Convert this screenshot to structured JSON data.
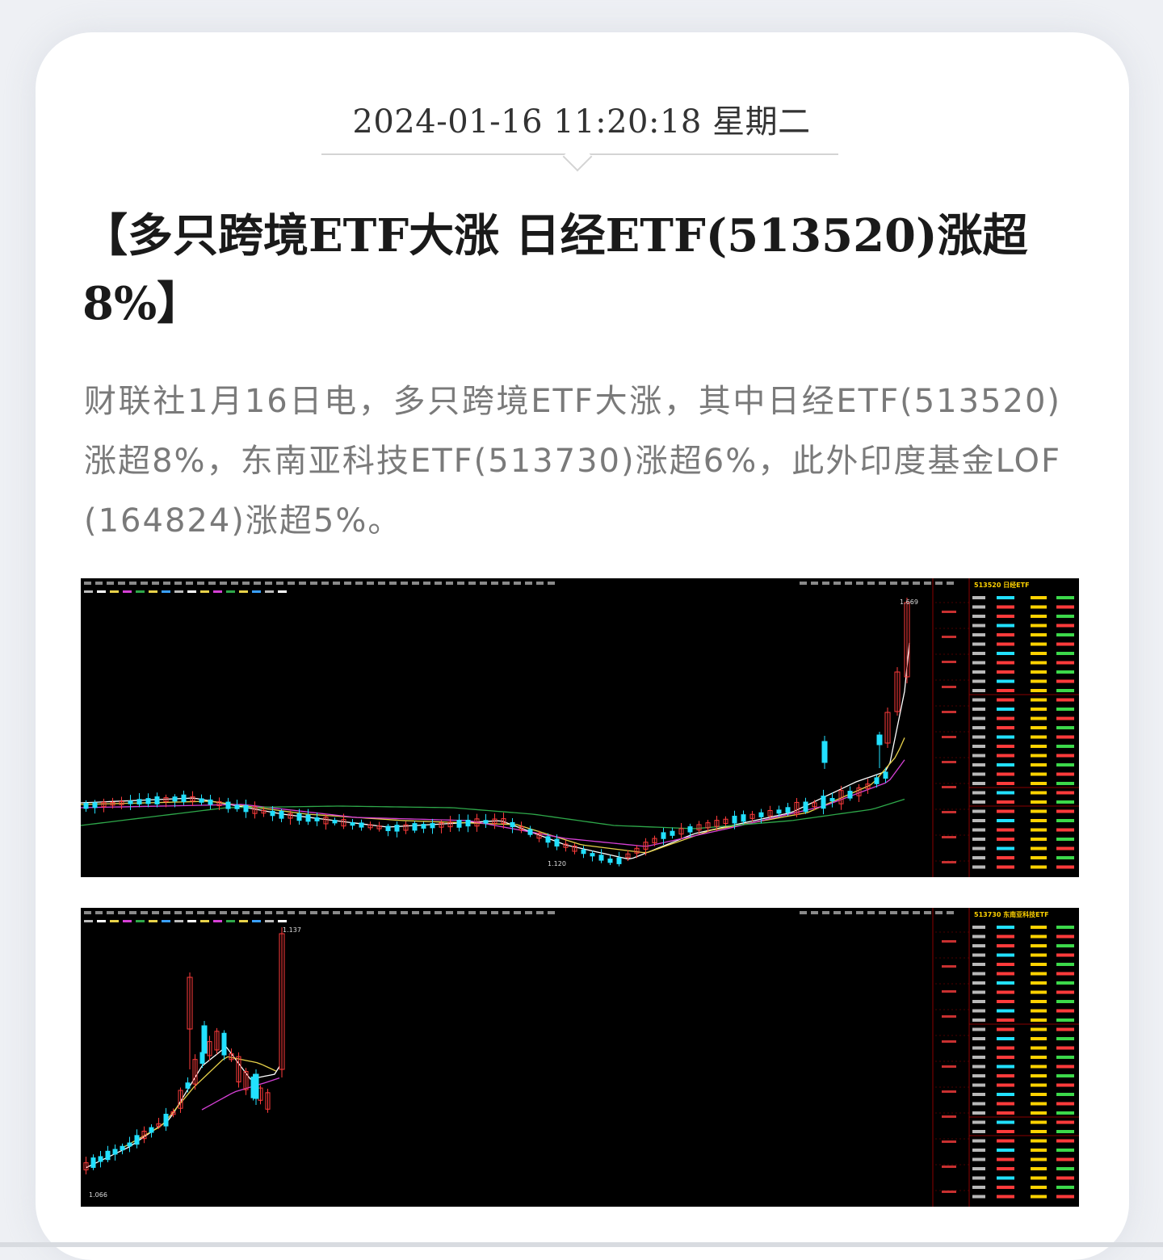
{
  "article": {
    "datetime": "2024-01-16 11:20:18 星期二",
    "title": "【多只跨境ETF大涨 日经ETF(513520)涨超8%】",
    "body": "财联社1月16日电，多只跨境ETF大涨，其中日经ETF(513520)涨超8%，东南亚科技ETF(513730)涨超6%，此外印度基金LOF(164824)涨超5%。"
  },
  "screenshots": [
    {
      "quote_header": "513520 日经ETF",
      "price_labels": {
        "high": "1.669",
        "low": "1.120"
      }
    },
    {
      "quote_header": "513730 东南亚科技ETF",
      "price_labels": {
        "high": "1.137",
        "low": "1.066"
      }
    }
  ],
  "colors": {
    "up": "#ff3b3b",
    "down": "#22e0ff",
    "ma5": "#ffffff",
    "ma10": "#e8d24a",
    "ma20": "#d640d6",
    "ma60": "#2ea84a",
    "background": "#000000"
  }
}
